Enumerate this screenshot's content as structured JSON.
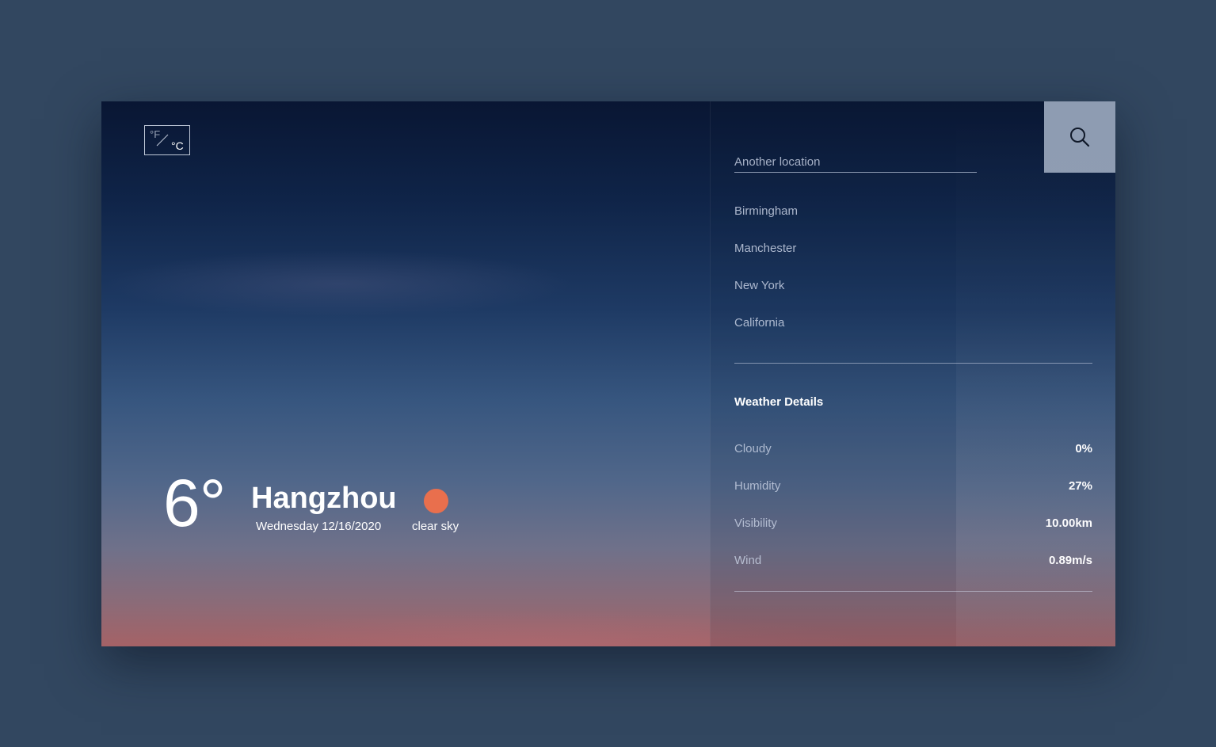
{
  "unit_toggle": {
    "fahrenheit": "°F",
    "celsius": "°C"
  },
  "current": {
    "temperature": "6°",
    "city": "Hangzhou",
    "date": "Wednesday 12/16/2020",
    "condition": "clear sky",
    "condition_icon": "sun-icon",
    "condition_icon_color": "#e96f4d"
  },
  "search": {
    "placeholder": "Another location",
    "value": "",
    "button_icon": "search-icon"
  },
  "locations": [
    "Birmingham",
    "Manchester",
    "New York",
    "California"
  ],
  "details": {
    "title": "Weather Details",
    "rows": [
      {
        "label": "Cloudy",
        "value": "0%"
      },
      {
        "label": "Humidity",
        "value": "27%"
      },
      {
        "label": "Visibility",
        "value": "10.00km"
      },
      {
        "label": "Wind",
        "value": "0.89m/s"
      }
    ]
  },
  "colors": {
    "page_background": "#324760",
    "accent": "#e96f4d",
    "search_button": "#8e9cb2"
  }
}
